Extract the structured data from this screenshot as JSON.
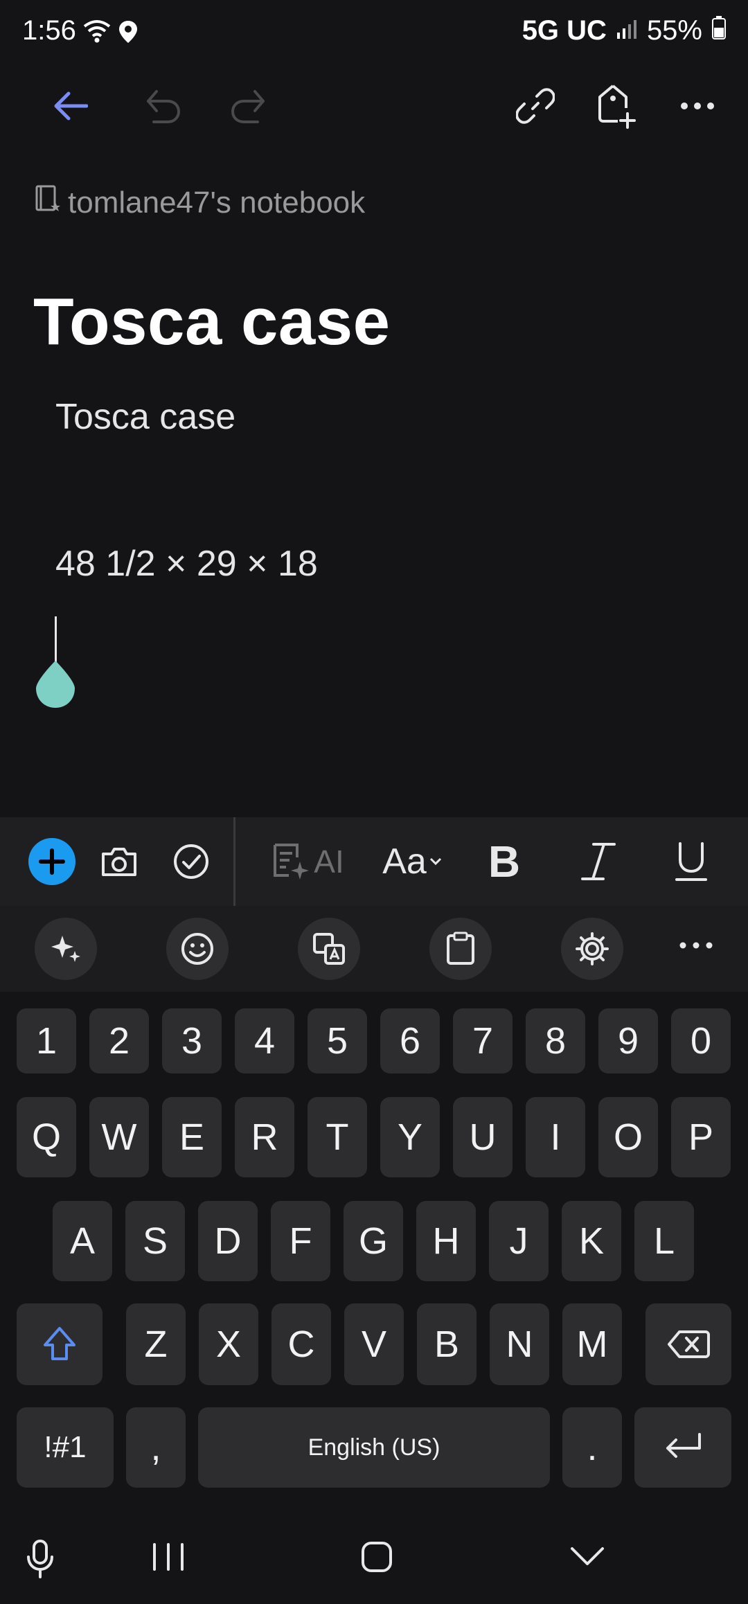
{
  "status": {
    "time": "1:56",
    "network": "5G UC",
    "battery": "55%"
  },
  "toolbar": {
    "icons": [
      "back-arrow-icon",
      "undo-icon",
      "redo-icon",
      "link-icon",
      "add-tag-icon",
      "more-icon"
    ]
  },
  "note": {
    "notebook": "tomlane47's notebook",
    "title": "Tosca case",
    "lines": [
      "Tosca case",
      "48 1/2 × 29 × 18"
    ]
  },
  "format_bar": {
    "ai_label": "AI",
    "text_style_label": "Aa",
    "bold_label": "B",
    "italic_label": "I",
    "underline_label": "U",
    "accent_color": "#1a9bf0"
  },
  "keyboard": {
    "number_row": [
      "1",
      "2",
      "3",
      "4",
      "5",
      "6",
      "7",
      "8",
      "9",
      "0"
    ],
    "row1": [
      "Q",
      "W",
      "E",
      "R",
      "T",
      "Y",
      "U",
      "I",
      "O",
      "P"
    ],
    "row2": [
      "A",
      "S",
      "D",
      "F",
      "G",
      "H",
      "J",
      "K",
      "L"
    ],
    "row3": [
      "Z",
      "X",
      "C",
      "V",
      "B",
      "N",
      "M"
    ],
    "symbols_label": "!#1",
    "comma_label": ",",
    "space_label": "English (US)",
    "period_label": ".",
    "shift_color": "#5b8def"
  }
}
